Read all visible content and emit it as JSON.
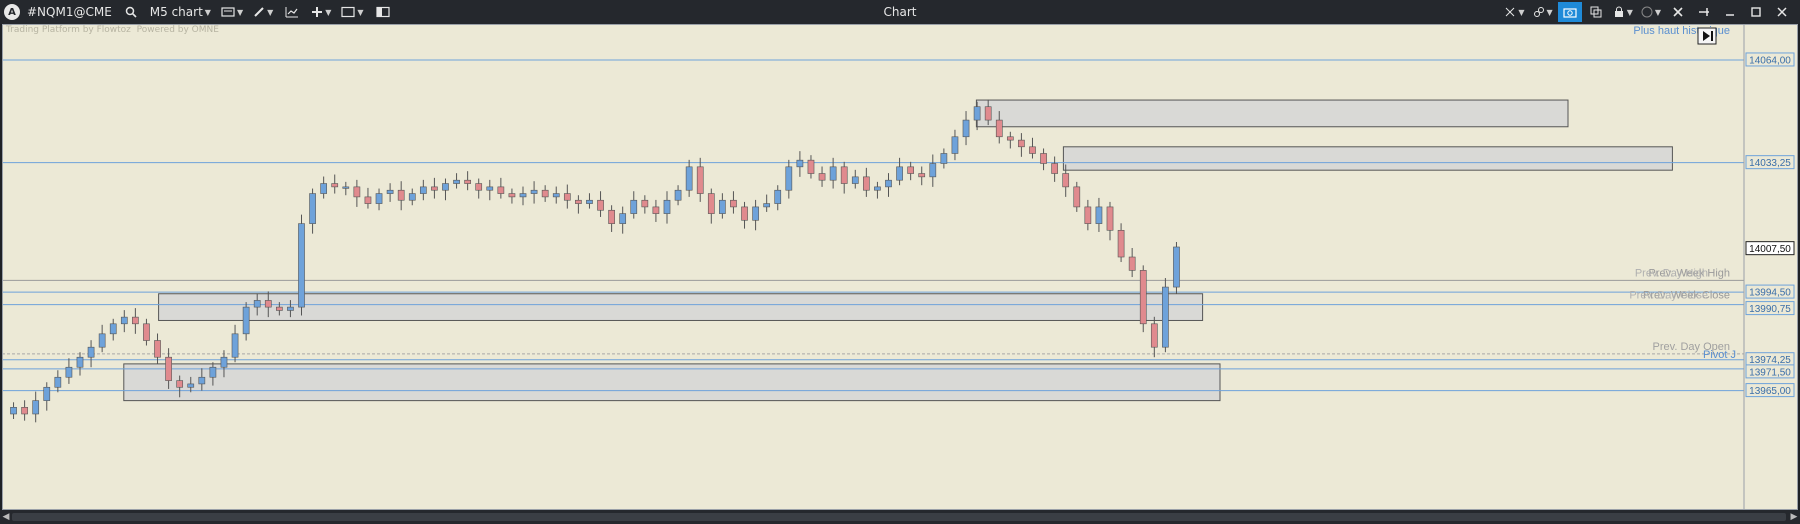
{
  "titlebar": {
    "symbol": "#NQM1@CME",
    "chart_type": "M5 chart",
    "title": "Chart"
  },
  "watermark": {
    "text1": "Trading Platform by Flowtoz",
    "text2": "Powered by OMNE"
  },
  "labels": {
    "plus_haut": "Plus haut historique",
    "prev_week_high": "Prev. Week High",
    "prev_day_high": "Prev. Day High",
    "prev_week_close": "Prev. Week Close",
    "prev_day_close": "Prev. Day Close",
    "prev_day_open": "Prev. Day Open",
    "pivot": "Pivot J"
  },
  "colors": {
    "background": "#ece9d6",
    "bull": "#6ea2da",
    "bear": "#e08a8e",
    "level_line": "#6ea2da",
    "zone_fill": "#d6d6d6",
    "axis_label_border": "#6ea2da"
  },
  "chart_data": {
    "type": "candlestick",
    "price_axis_labels": [
      "14064,00",
      "14033,25",
      "14007,50",
      "13994,50",
      "13990,75",
      "13974,25",
      "13971,50",
      "13965,00"
    ],
    "current_price": "14007,50",
    "ylim": [
      13955,
      14070
    ],
    "levels": [
      14064.0,
      14033.25,
      13994.5,
      13990.75,
      13974.25,
      13971.5,
      13965.0
    ],
    "zones": [
      {
        "from": 0.56,
        "to": 0.9,
        "low": 14044,
        "high": 14052
      },
      {
        "from": 0.61,
        "to": 0.96,
        "low": 14031,
        "high": 14038
      },
      {
        "from": 0.09,
        "to": 0.69,
        "low": 13986,
        "high": 13994
      },
      {
        "from": 0.07,
        "to": 0.7,
        "low": 13962,
        "high": 13973
      }
    ],
    "closes": [
      13960,
      13958,
      13962,
      13966,
      13969,
      13972,
      13975,
      13978,
      13982,
      13985,
      13987,
      13985,
      13980,
      13975,
      13968,
      13966,
      13967,
      13969,
      13972,
      13975,
      13982,
      13990,
      13992,
      13990,
      13989,
      13990,
      14015,
      14024,
      14027,
      14026,
      14026,
      14023,
      14021,
      14024,
      14025,
      14022,
      14024,
      14026,
      14025,
      14027,
      14028,
      14027,
      14025,
      14026,
      14024,
      14023,
      14024,
      14025,
      14023,
      14024,
      14022,
      14021,
      14022,
      14019,
      14015,
      14018,
      14022,
      14020,
      14018,
      14022,
      14025,
      14032,
      14024,
      14018,
      14022,
      14020,
      14016,
      14020,
      14021,
      14025,
      14032,
      14034,
      14030,
      14028,
      14032,
      14027,
      14029,
      14025,
      14026,
      14028,
      14032,
      14030,
      14029,
      14033,
      14036,
      14041,
      14046,
      14050,
      14046,
      14041,
      14040,
      14038,
      14036,
      14033,
      14030,
      14026,
      14020,
      14015,
      14020,
      14013,
      14005,
      14001,
      13985,
      13978,
      13996,
      14008
    ]
  }
}
